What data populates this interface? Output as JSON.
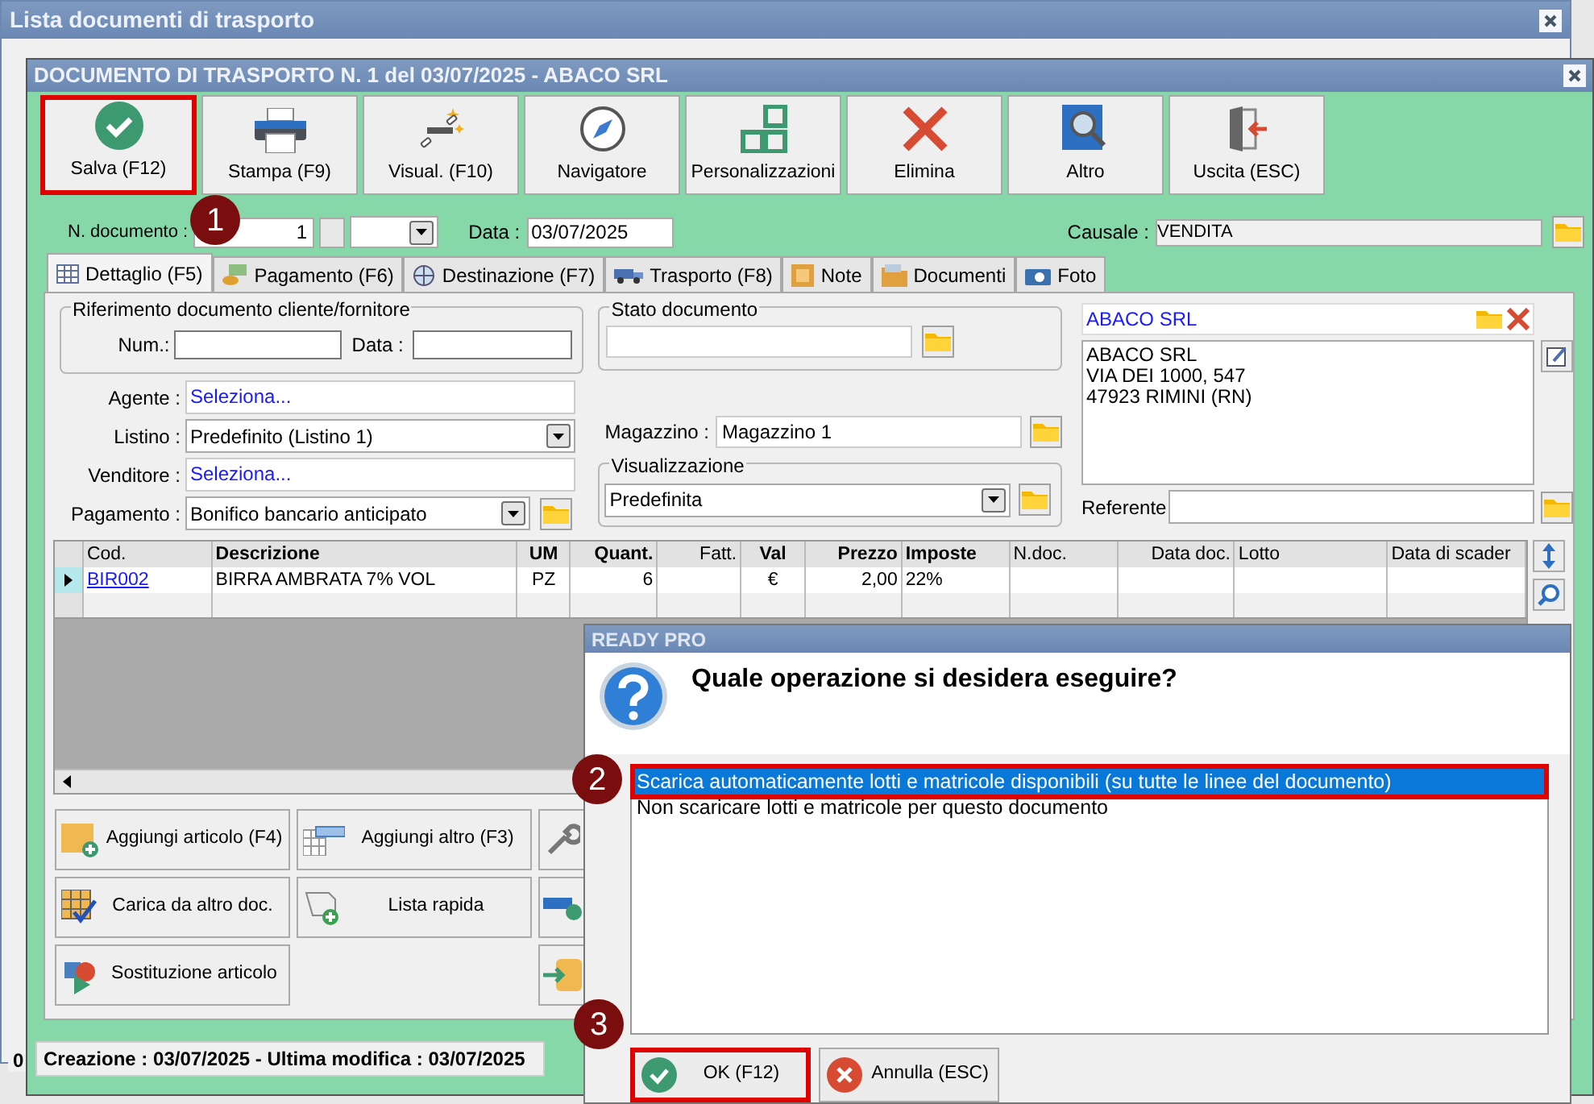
{
  "background_window": {
    "title": "Lista documenti di trasporto",
    "status_text": "0"
  },
  "window": {
    "title": "DOCUMENTO DI TRASPORTO N. 1 del 03/07/2025 - ABACO SRL"
  },
  "toolbar": [
    {
      "label": "Salva (F12)",
      "highlighted": true
    },
    {
      "label": "Stampa (F9)",
      "highlighted": false
    },
    {
      "label": "Visual. (F10)",
      "highlighted": false
    },
    {
      "label": "Navigatore",
      "highlighted": false
    },
    {
      "label": "Personalizzazioni",
      "highlighted": false
    },
    {
      "label": "Elimina",
      "highlighted": false
    },
    {
      "label": "Altro",
      "highlighted": false
    },
    {
      "label": "Uscita (ESC)",
      "highlighted": false
    }
  ],
  "header": {
    "number_label": "N. documento :",
    "number": "1",
    "date_label": "Data :",
    "date": "03/07/2025",
    "causale_label": "Causale :",
    "causale": "VENDITA"
  },
  "tabs": [
    {
      "label": "Dettaglio (F5)",
      "selected": true
    },
    {
      "label": "Pagamento (F6)",
      "selected": false
    },
    {
      "label": "Destinazione (F7)",
      "selected": false
    },
    {
      "label": "Trasporto (F8)",
      "selected": false
    },
    {
      "label": "Note",
      "selected": false
    },
    {
      "label": "Documenti",
      "selected": false
    },
    {
      "label": "Foto",
      "selected": false
    }
  ],
  "reference": {
    "legend": "Riferimento documento cliente/fornitore",
    "num_label": "Num.:",
    "date_label": "Data :"
  },
  "fields": [
    {
      "label": "Agente :",
      "value": "Seleziona...",
      "kind": "link"
    },
    {
      "label": "Listino :",
      "value": "Predefinito (Listino 1)",
      "kind": "dropdown"
    },
    {
      "label": "Venditore :",
      "value": "Seleziona...",
      "kind": "link"
    },
    {
      "label": "Pagamento :",
      "value": "Bonifico bancario anticipato",
      "kind": "dropdown_folder"
    }
  ],
  "document_state": {
    "legend": "Stato documento"
  },
  "warehouse": {
    "label": "Magazzino :",
    "value": "Magazzino 1"
  },
  "view": {
    "legend": "Visualizzazione",
    "value": "Predefinita"
  },
  "customer": {
    "name": "ABACO SRL",
    "address": [
      "ABACO SRL",
      "VIA DEI 1000, 547",
      "47923 RIMINI (RN)"
    ],
    "contact_label": "Referente"
  },
  "table": {
    "columns": [
      "Cod.",
      "Descrizione",
      "UM",
      "Quant.",
      "Fatt.",
      "Val",
      "Prezzo",
      "Imposte",
      "N.doc.",
      "Data doc.",
      "Lotto",
      "Data di scader"
    ],
    "rows": [
      {
        "current": true,
        "cells": [
          "BIR002",
          "BIRRA AMBRATA 7% VOL",
          "PZ",
          "6",
          "",
          "€",
          "2,00",
          "22%",
          "",
          "",
          "",
          ""
        ]
      }
    ]
  },
  "actions": [
    "Aggiungi articolo (F4)",
    "Aggiungi altro (F3)",
    "Carica da altro doc.",
    "Lista rapida",
    "Sostituzione articolo"
  ],
  "status_bar": "Creazione : 03/07/2025 - Ultima modifica : 03/07/2025",
  "dialog": {
    "title": "READY PRO",
    "question": "Quale operazione si desidera eseguire?",
    "options": [
      {
        "label": "Scarica automaticamente lotti e matricole disponibili (su tutte le linee del documento)",
        "selected": true,
        "highlighted": true
      },
      {
        "label": "Non scaricare lotti e matricole per questo documento",
        "selected": false,
        "highlighted": false
      }
    ],
    "buttons": [
      {
        "label": "OK (F12)",
        "highlighted": true
      },
      {
        "label": "Annulla (ESC)",
        "highlighted": false
      }
    ]
  },
  "callouts": [
    "1",
    "2",
    "3"
  ]
}
